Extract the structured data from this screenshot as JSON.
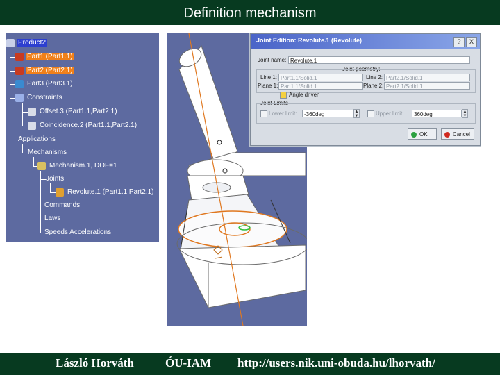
{
  "header": {
    "title": "Definition mechanism"
  },
  "footer": {
    "author": "László Horváth",
    "institution": "ÓU-IAM",
    "url": "http://users.nik.uni-obuda.hu/lhorvath/"
  },
  "colors": {
    "header_bg": "#073a20",
    "panel_bg": "#5d6aa0",
    "highlight": "#f0801a",
    "part_orange": "#e07820"
  },
  "spec_tree": {
    "root": "Product2",
    "items": [
      {
        "label": "Part1 (Part1.1)",
        "icon": "part-icon"
      },
      {
        "label": "Part2 (Part2.1)",
        "icon": "part-icon"
      },
      {
        "label": "Part3 (Part3.1)",
        "icon": "part-icon"
      },
      {
        "label": "Constraints",
        "icon": "constraints-icon"
      },
      {
        "label": "Offset.3 (Part1.1,Part2.1)",
        "icon": "offset-constraint-icon"
      },
      {
        "label": "Coincidence.2 (Part1.1,Part2.1)",
        "icon": "coincidence-constraint-icon"
      },
      {
        "label": "Applications",
        "icon": ""
      },
      {
        "label": "Mechanisms",
        "icon": ""
      },
      {
        "label": "Mechanism.1, DOF=1",
        "icon": "mechanism-icon"
      },
      {
        "label": "Joints",
        "icon": ""
      },
      {
        "label": "Revolute.1 (Part1.1,Part2.1)",
        "icon": "revolute-joint-icon"
      },
      {
        "label": "Commands",
        "icon": ""
      },
      {
        "label": "Laws",
        "icon": ""
      },
      {
        "label": "Speeds Accelerations",
        "icon": ""
      }
    ]
  },
  "dialog": {
    "title": "Joint Edition: Revolute.1 (Revolute)",
    "help_label": "?",
    "close_label": "X",
    "joint_name_label": "Joint name:",
    "joint_name_value": "Revolute.1",
    "geometry_label": "Joint geometry:",
    "line1_label": "Line 1:",
    "line1_value": "Part1.1/Solid.1",
    "line2_label": "Line 2:",
    "line2_value": "Part2.1/Solid.1",
    "plane1_label": "Plane 1:",
    "plane1_value": "Part1.1/Solid.1",
    "plane2_label": "Plane 2:",
    "plane2_value": "Part2.1/Solid.1",
    "angle_driven_label": "Angle driven",
    "angle_driven_checked": true,
    "limits_label": "Joint Limits",
    "lower_limit_label": "Lower limit:",
    "lower_limit_value": "-360deg",
    "upper_limit_label": "Upper limit:",
    "upper_limit_value": "360deg",
    "ok_label": "OK",
    "cancel_label": "Cancel"
  }
}
